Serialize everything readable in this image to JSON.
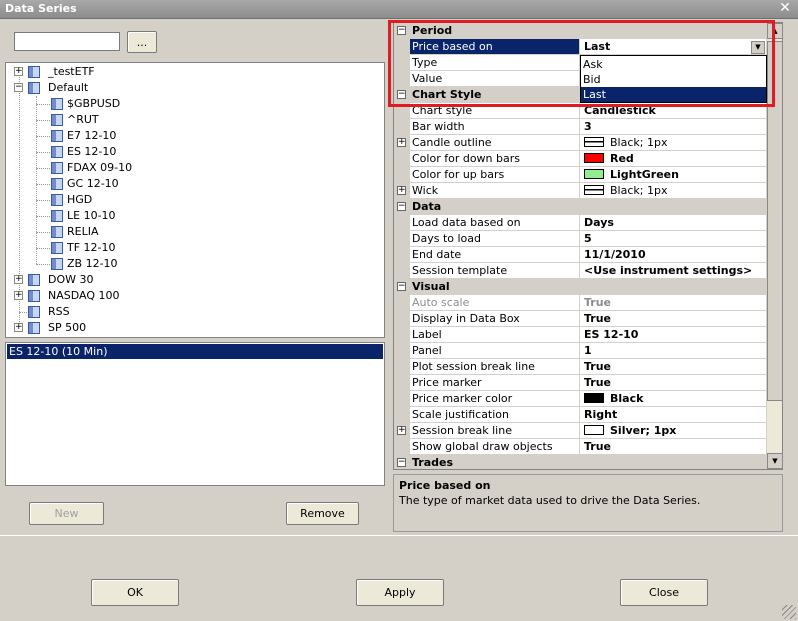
{
  "window": {
    "title": "Data Series",
    "close_glyph": "✕"
  },
  "search": {
    "value": "",
    "browse_label": "..."
  },
  "tree": [
    {
      "label": "_testETF",
      "depth": 0,
      "expander": "+"
    },
    {
      "label": "Default",
      "depth": 0,
      "expander": "−"
    },
    {
      "label": "$GBPUSD",
      "depth": 1
    },
    {
      "label": "^RUT",
      "depth": 1
    },
    {
      "label": "E7 12-10",
      "depth": 1
    },
    {
      "label": "ES 12-10",
      "depth": 1
    },
    {
      "label": "FDAX 09-10",
      "depth": 1
    },
    {
      "label": "GC 12-10",
      "depth": 1
    },
    {
      "label": "HGD",
      "depth": 1
    },
    {
      "label": "LE 10-10",
      "depth": 1
    },
    {
      "label": "RELIA",
      "depth": 1
    },
    {
      "label": "TF 12-10",
      "depth": 1
    },
    {
      "label": "ZB 12-10",
      "depth": 1
    },
    {
      "label": "DOW 30",
      "depth": 0,
      "expander": "+"
    },
    {
      "label": "NASDAQ 100",
      "depth": 0,
      "expander": "+"
    },
    {
      "label": "RSS",
      "depth": 0
    },
    {
      "label": "SP 500",
      "depth": 0,
      "expander": "+"
    }
  ],
  "series_list": [
    {
      "label": "ES 12-10 (10 Min)",
      "selected": true
    }
  ],
  "buttons": {
    "new": "New",
    "remove": "Remove",
    "ok": "OK",
    "apply": "Apply",
    "close": "Close"
  },
  "colors": {
    "red": "#ff0000",
    "light_green": "#90ee90",
    "black": "#000000",
    "silver": "#ffffff"
  },
  "property_grid": [
    {
      "kind": "category",
      "label": "Period",
      "expander": "−"
    },
    {
      "kind": "prop",
      "name": "Price based on",
      "value": "Last",
      "selected": true
    },
    {
      "kind": "prop",
      "name": "Type",
      "value": ""
    },
    {
      "kind": "prop",
      "name": "Value",
      "value": ""
    },
    {
      "kind": "category",
      "label": "Chart Style",
      "expander": "−"
    },
    {
      "kind": "prop",
      "name": "Chart style",
      "value": "Candlestick"
    },
    {
      "kind": "prop",
      "name": "Bar width",
      "value": "3"
    },
    {
      "kind": "prop",
      "name": "Candle outline",
      "value": "Black; 1px",
      "swatch": "line",
      "expander": "+",
      "plain": true
    },
    {
      "kind": "prop",
      "name": "Color for down bars",
      "value": "Red",
      "swatch": "#ff0000"
    },
    {
      "kind": "prop",
      "name": "Color for up bars",
      "value": "LightGreen",
      "swatch": "#90ee90"
    },
    {
      "kind": "prop",
      "name": "Wick",
      "value": "Black; 1px",
      "swatch": "line",
      "expander": "+",
      "plain": true
    },
    {
      "kind": "category",
      "label": "Data",
      "expander": "−"
    },
    {
      "kind": "prop",
      "name": "Load data based on",
      "value": "Days"
    },
    {
      "kind": "prop",
      "name": "Days to load",
      "value": "5"
    },
    {
      "kind": "prop",
      "name": "End date",
      "value": "11/1/2010"
    },
    {
      "kind": "prop",
      "name": "Session template",
      "value": "<Use instrument settings>"
    },
    {
      "kind": "category",
      "label": "Visual",
      "expander": "−"
    },
    {
      "kind": "prop",
      "name": "Auto scale",
      "value": "True",
      "disabled": true
    },
    {
      "kind": "prop",
      "name": "Display in Data Box",
      "value": "True"
    },
    {
      "kind": "prop",
      "name": "Label",
      "value": "ES 12-10"
    },
    {
      "kind": "prop",
      "name": "Panel",
      "value": "1"
    },
    {
      "kind": "prop",
      "name": "Plot session break line",
      "value": "True"
    },
    {
      "kind": "prop",
      "name": "Price marker",
      "value": "True"
    },
    {
      "kind": "prop",
      "name": "Price marker color",
      "value": "Black",
      "swatch": "#000000"
    },
    {
      "kind": "prop",
      "name": "Scale justification",
      "value": "Right"
    },
    {
      "kind": "prop",
      "name": "Session break line",
      "value": "Silver; 1px",
      "swatch": "#ffffff",
      "expander": "+"
    },
    {
      "kind": "prop",
      "name": "Show global draw objects",
      "value": "True"
    },
    {
      "kind": "category",
      "label": "Trades",
      "expander": "−"
    }
  ],
  "dropdown": {
    "options": [
      {
        "label": "Ask",
        "selected": false
      },
      {
        "label": "Bid",
        "selected": false
      },
      {
        "label": "Last",
        "selected": true
      }
    ]
  },
  "description": {
    "title": "Price based on",
    "text": "The type of market data used to drive the Data Series."
  }
}
